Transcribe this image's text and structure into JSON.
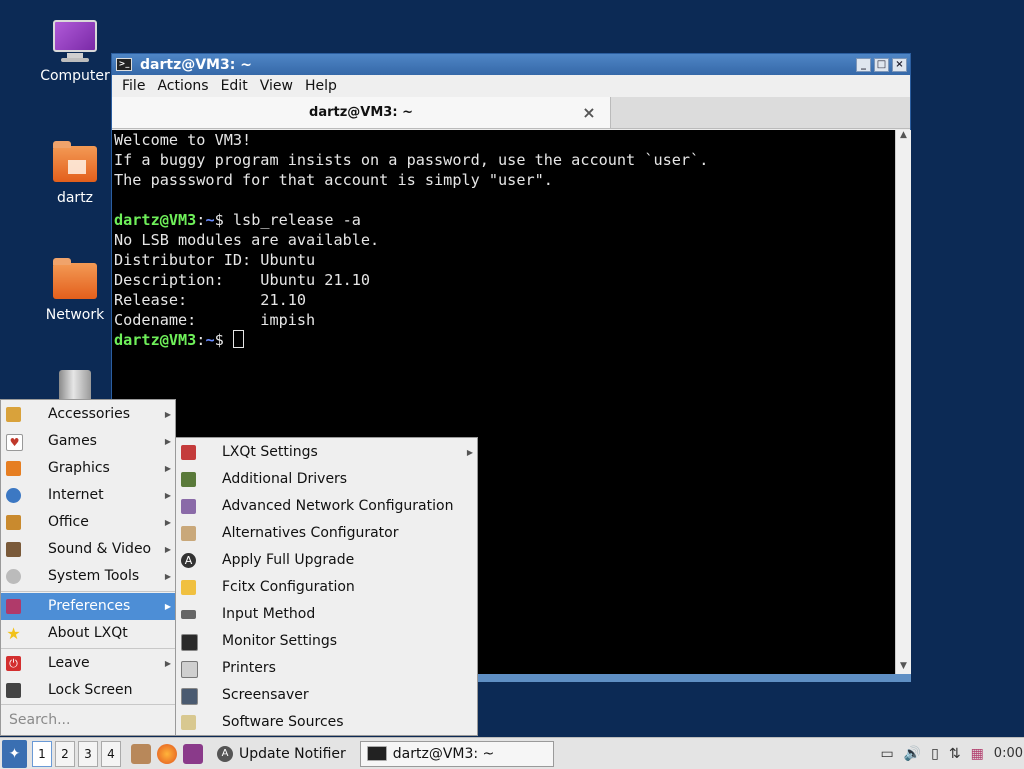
{
  "desktop": {
    "icons": [
      {
        "label": "Computer"
      },
      {
        "label": "dartz"
      },
      {
        "label": "Network"
      },
      {
        "label": ""
      }
    ]
  },
  "window": {
    "title": "dartz@VM3: ~",
    "menus": [
      "File",
      "Actions",
      "Edit",
      "View",
      "Help"
    ],
    "tab_label": "dartz@VM3: ~",
    "tab_close_icon": "×"
  },
  "terminal": {
    "lines": [
      "Welcome to VM3!",
      "If a buggy program insists on a password, use the account `user`.",
      "The passsword for that account is simply \"user\".",
      "",
      "No LSB modules are available.",
      "Distributor ID: Ubuntu",
      "Description:    Ubuntu 21.10",
      "Release:        21.10",
      "Codename:       impish"
    ],
    "prompt_user": "dartz@VM3",
    "prompt_sep": ":",
    "prompt_path": "~",
    "prompt_dollar": "$ ",
    "command": "lsb_release -a"
  },
  "start_menu": {
    "items": [
      {
        "label": "Accessories",
        "icon": "accessories-icon",
        "color": "#d9a23b",
        "submenu": true
      },
      {
        "label": "Games",
        "icon": "games-icon",
        "color": "#c0392b",
        "submenu": true
      },
      {
        "label": "Graphics",
        "icon": "graphics-icon",
        "color": "#e67e22",
        "submenu": true
      },
      {
        "label": "Internet",
        "icon": "internet-icon",
        "color": "#3c78c3",
        "submenu": true
      },
      {
        "label": "Office",
        "icon": "office-icon",
        "color": "#c98a2e",
        "submenu": true
      },
      {
        "label": "Sound & Video",
        "icon": "sound-video-icon",
        "color": "#7a5a3a",
        "submenu": true
      },
      {
        "label": "System Tools",
        "icon": "system-tools-icon",
        "color": "#9a9a9a",
        "submenu": true
      },
      {
        "label": "Preferences",
        "icon": "preferences-icon",
        "color": "#b03a6a",
        "submenu": true,
        "selected": true
      },
      {
        "label": "About LXQt",
        "icon": "star-icon",
        "color": "#f2c21a",
        "submenu": false
      },
      {
        "label": "Leave",
        "icon": "power-icon",
        "color": "#d32f2f",
        "submenu": true
      },
      {
        "label": "Lock Screen",
        "icon": "lock-screen-icon",
        "color": "#444",
        "submenu": false
      }
    ],
    "search_placeholder": "Search..."
  },
  "preferences_submenu": {
    "items": [
      {
        "label": "LXQt Settings",
        "icon": "settings-icon",
        "submenu": true
      },
      {
        "label": "Additional Drivers",
        "icon": "drivers-icon",
        "submenu": false
      },
      {
        "label": "Advanced Network Configuration",
        "icon": "network-config-icon",
        "submenu": false
      },
      {
        "label": "Alternatives Configurator",
        "icon": "alternatives-icon",
        "submenu": false
      },
      {
        "label": "Apply Full Upgrade",
        "icon": "upgrade-icon",
        "submenu": false
      },
      {
        "label": "Fcitx Configuration",
        "icon": "fcitx-icon",
        "submenu": false
      },
      {
        "label": "Input Method",
        "icon": "keyboard-icon",
        "submenu": false
      },
      {
        "label": "Monitor Settings",
        "icon": "monitor-icon",
        "submenu": false
      },
      {
        "label": "Printers",
        "icon": "printer-icon",
        "submenu": false
      },
      {
        "label": "Screensaver",
        "icon": "screensaver-icon",
        "submenu": false
      },
      {
        "label": "Software Sources",
        "icon": "software-sources-icon",
        "submenu": false
      }
    ]
  },
  "taskbar": {
    "desktops": [
      "1",
      "2",
      "3",
      "4"
    ],
    "tasks": [
      {
        "label": "Update Notifier"
      },
      {
        "label": "dartz@VM3: ~"
      }
    ],
    "clock": "0:00"
  }
}
